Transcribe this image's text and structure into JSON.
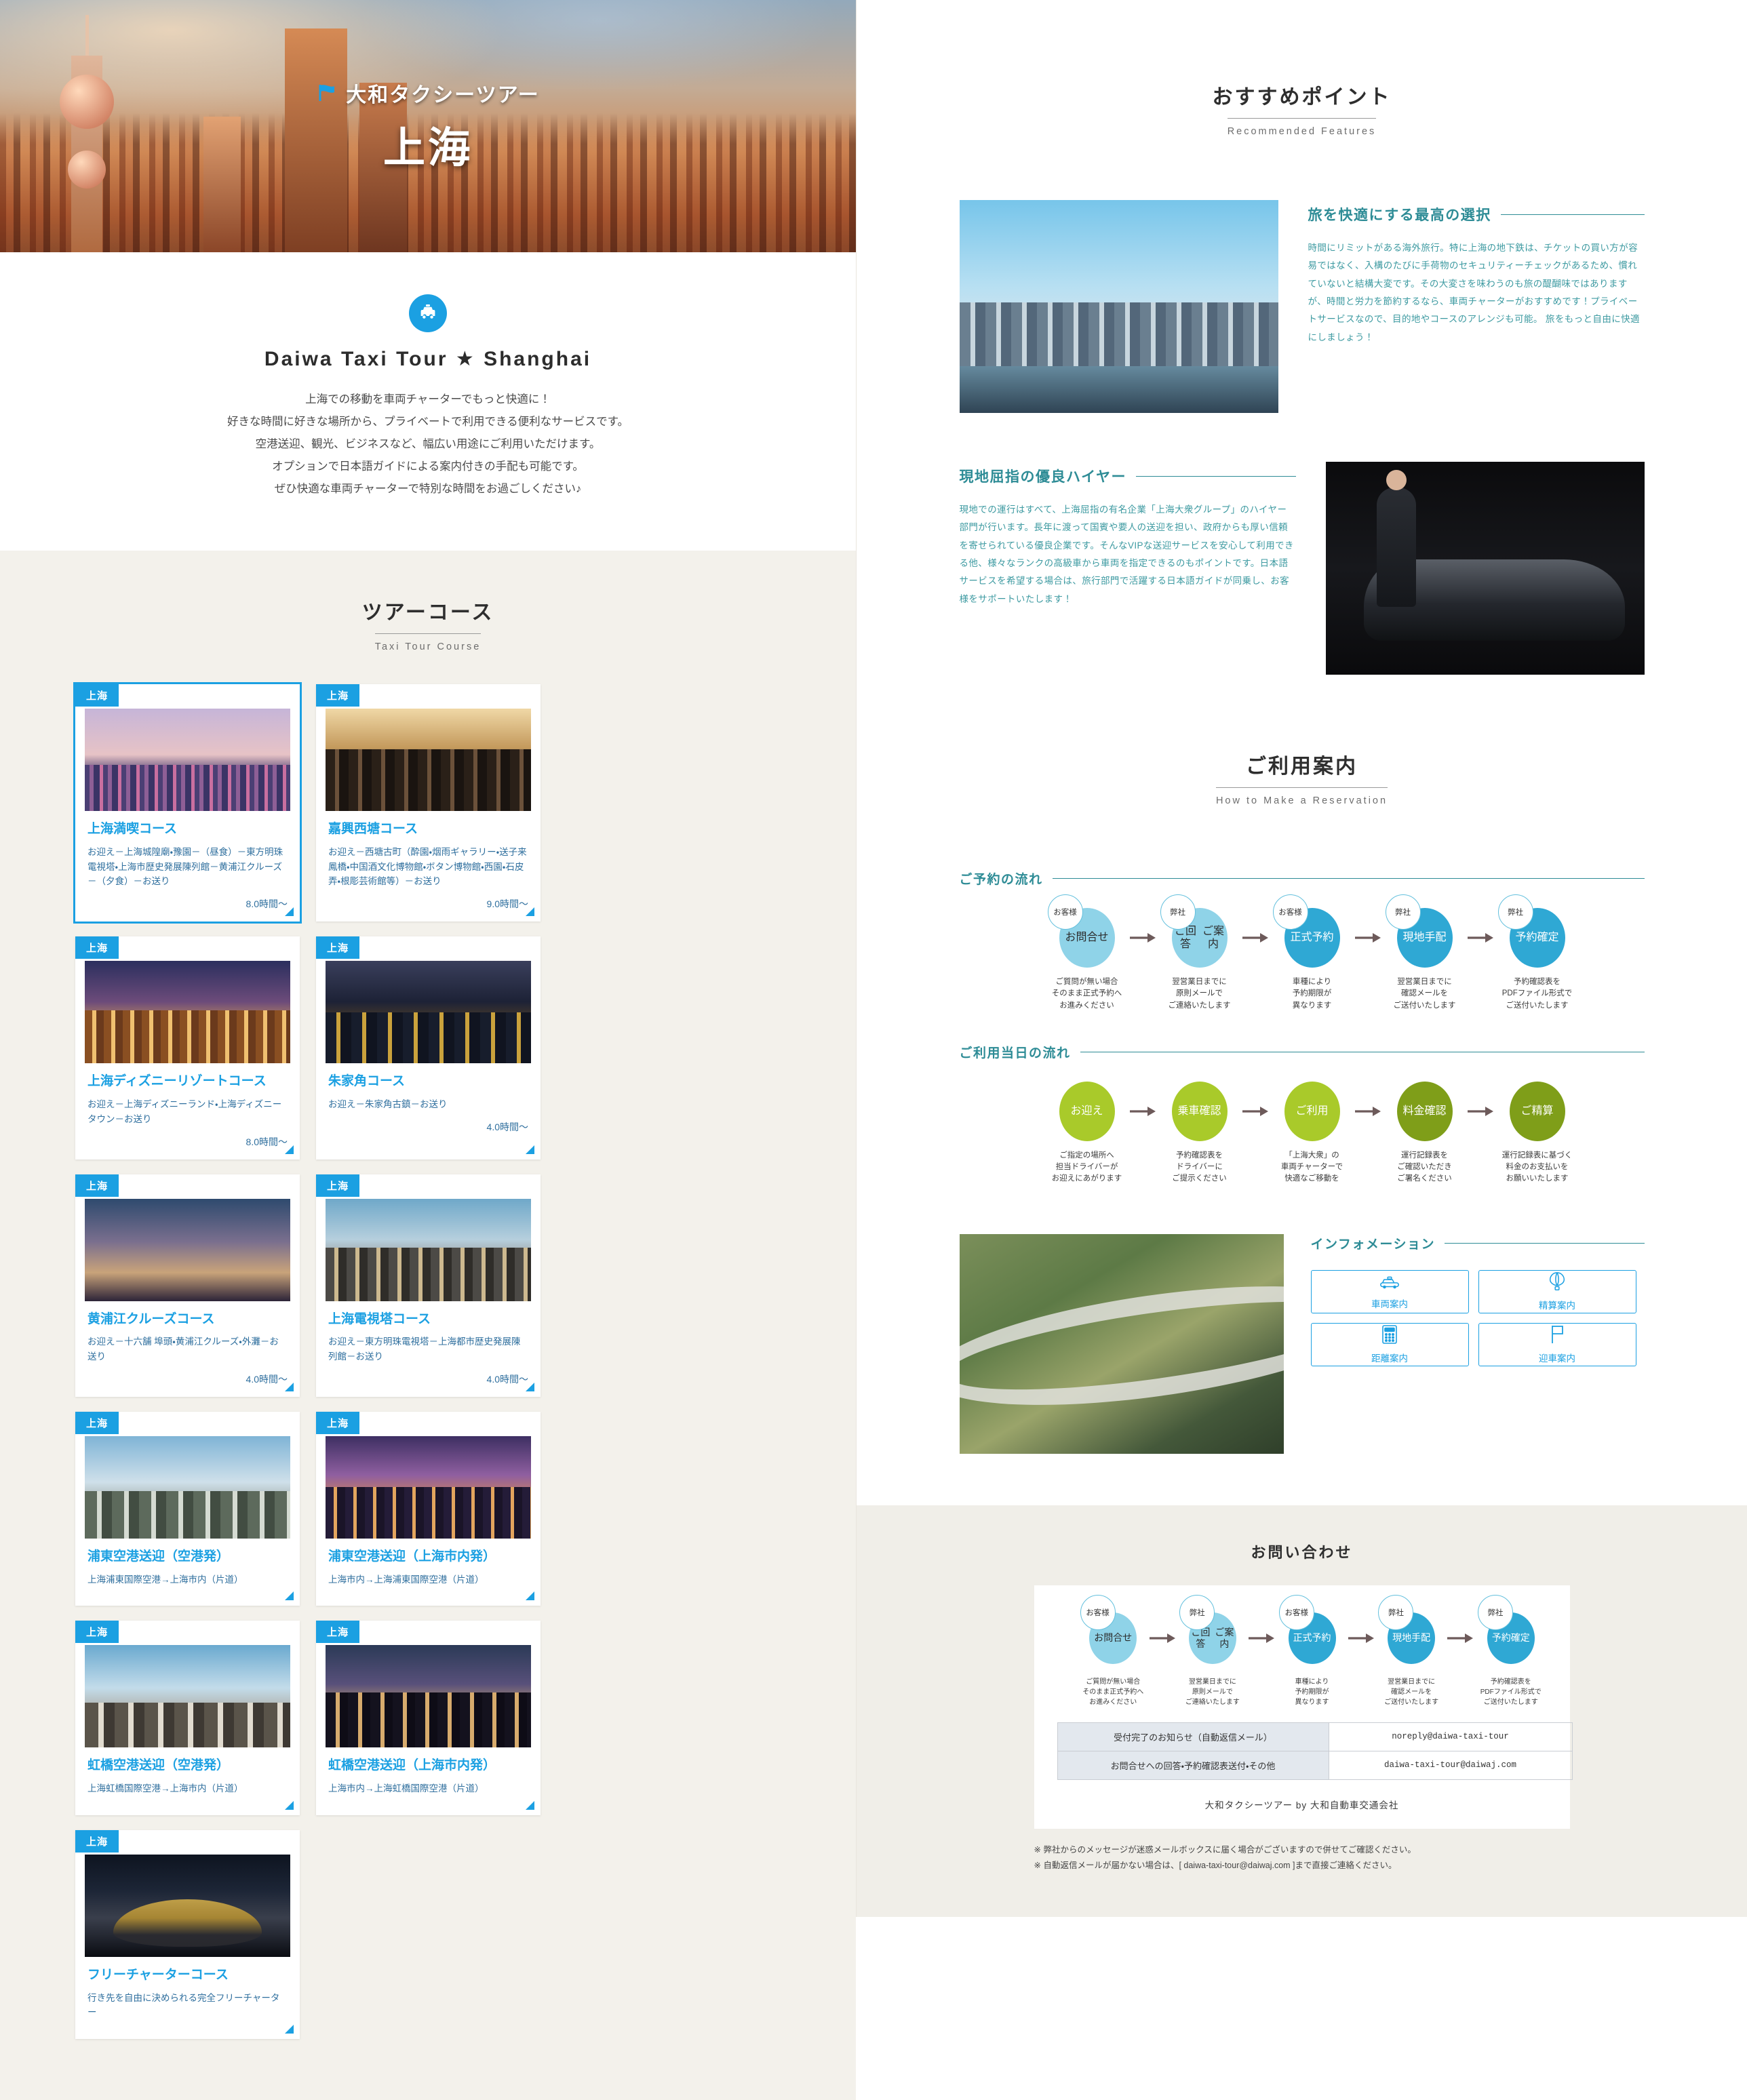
{
  "hero": {
    "kicker": "大和タクシーツアー",
    "title": "上海",
    "flag_icon": "flag-icon"
  },
  "intro": {
    "badge_icon": "taxi-icon",
    "title": "Daiwa Taxi Tour ★ Shanghai",
    "lines": [
      "上海での移動を車両チャーターでもっと快適に！",
      "好きな時間に好きな場所から、プライベートで利用できる便利なサービスです。",
      "空港送迎、観光、ビジネスなど、幅広い用途にご利用いただけます。",
      "オプションで日本語ガイドによる案内付きの手配も可能です。",
      "ぜひ快適な車両チャーターで特別な時間をお過ごしください♪"
    ]
  },
  "courses_section": {
    "heading_ja": "ツアーコース",
    "heading_en": "Taxi Tour Course",
    "tag": "上海",
    "cards": [
      {
        "title": "上海満喫コース",
        "desc": "お迎え－上海城隍廟・豫園－（昼食）－東方明珠電視塔・上海市歴史発展陳列館－黄浦江クルーズ－（夕食）－お送り",
        "time": "8.0時間～",
        "scene": "sc1",
        "active": true
      },
      {
        "title": "嘉興西塘コース",
        "desc": "お迎え－西塘古町（酔園・烟雨ギャラリー・送子来鳳橋・中国酒文化博物館・ボタン博物館・西園・石皮弄・根彫芸術館等）－お送り",
        "time": "9.0時間～",
        "scene": "sc2",
        "active": false
      },
      {
        "title": "上海ディズニーリゾートコース",
        "desc": "お迎え－上海ディズニーランド・上海ディズニータウン－お送り",
        "time": "8.0時間～",
        "scene": "sc3",
        "active": false
      },
      {
        "title": "朱家角コース",
        "desc": "お迎え－朱家角古鎮－お送り",
        "time": "4.0時間～",
        "scene": "sc4",
        "active": false
      },
      {
        "title": "黄浦江クルーズコース",
        "desc": "お迎え－十六舗 埠頭・黄浦江クルーズ・外灘－お送り",
        "time": "4.0時間～",
        "scene": "sc5",
        "active": false
      },
      {
        "title": "上海電視塔コース",
        "desc": "お迎え－東方明珠電視塔－上海都市歴史発展陳列館－お送り",
        "time": "4.0時間～",
        "scene": "sc6",
        "active": false
      },
      {
        "title": "浦東空港送迎（空港発）",
        "desc": "上海浦東国際空港→上海市内（片道）",
        "time": "",
        "scene": "sc7",
        "active": false
      },
      {
        "title": "浦東空港送迎（上海市内発）",
        "desc": "上海市内→上海浦東国際空港（片道）",
        "time": "",
        "scene": "sc8",
        "active": false
      },
      {
        "title": "虹橋空港送迎（空港発）",
        "desc": "上海虹橋国際空港→上海市内（片道）",
        "time": "",
        "scene": "sc9",
        "active": false
      },
      {
        "title": "虹橋空港送迎（上海市内発）",
        "desc": "上海市内→上海虹橋国際空港（片道）",
        "time": "",
        "scene": "sc10",
        "active": false
      },
      {
        "title": "フリーチャーターコース",
        "desc": "行き先を自由に決められる完全フリーチャーター",
        "time": "",
        "scene": "sc11",
        "active": false
      }
    ]
  },
  "recommended": {
    "heading_ja": "おすすめポイント",
    "heading_en": "Recommended Features",
    "features": [
      {
        "title": "旅を快適にする最高の選択",
        "body": "時間にリミットがある海外旅行。特に上海の地下鉄は、チケットの買い方が容易ではなく、入構のたびに手荷物のセキュリティーチェックがあるため、慣れていないと結構大変です。その大変さを味わうのも旅の醍醐味ではありますが、時間と労力を節約するなら、車両チャーターがおすすめです！プライベートサービスなので、目的地やコースのアレンジも可能。 旅をもっと自由に快適にしましょう！",
        "image": "shanghai-skyline-photo"
      },
      {
        "title": "現地屈指の優良ハイヤー",
        "body": "現地での運行はすべて、上海屈指の有名企業「上海大衆グループ」のハイヤー部門が行います。長年に渡って国賓や要人の送迎を担い、政府からも厚い信頼を寄せられている優良企業です。そんなVIPな送迎サービスを安心して利用できる他、様々なランクの高級車から車両を指定できるのもポイントです。日本語サービスを希望する場合は、旅行部門で活躍する日本語ガイドが同乗し、お客様をサポートいたします！",
        "image": "chauffeur-luxury-car-photo"
      }
    ]
  },
  "how_to": {
    "heading_ja": "ご利用案内",
    "heading_en": "How to Make a Reservation",
    "reservation_flow": {
      "label": "ご予約の流れ",
      "steps": [
        {
          "badge": "お客様",
          "name": "お問合せ",
          "caption": "ご質問が無い場合\nそのまま正式予約へ\nお進みください",
          "color": "#8fd3e8"
        },
        {
          "badge": "弊社",
          "name": "ご回答\nご案内",
          "caption": "翌営業日までに\n原則メールで\nご連絡いたします",
          "color": "#8fd3e8"
        },
        {
          "badge": "お客様",
          "name": "正式予約",
          "caption": "車種により\n予約期限が\n異なります",
          "color": "#2fa8d4"
        },
        {
          "badge": "弊社",
          "name": "現地手配",
          "caption": "翌営業日までに\n確認メールを\nご送付いたします",
          "color": "#2fa8d4"
        },
        {
          "badge": "弊社",
          "name": "予約確定",
          "caption": "予約確認表を\nPDFファイル形式で\nご送付いたします",
          "color": "#2fa8d4"
        }
      ]
    },
    "day_flow": {
      "label": "ご利用当日の流れ",
      "steps": [
        {
          "name": "お迎え",
          "caption": "ご指定の場所へ\n担当ドライバーが\nお迎えにあがります",
          "color": "#a9ca2a"
        },
        {
          "name": "乗車確認",
          "caption": "予約確認表を\nドライバーに\nご提示ください",
          "color": "#a9ca2a"
        },
        {
          "name": "ご利用",
          "caption": "「上海大衆」の\n車両チャーターで\n快適なご移動を",
          "color": "#a9ca2a"
        },
        {
          "name": "料金確認",
          "caption": "運行記録表を\nご確認いただき\nご署名ください",
          "color": "#7f9e19"
        },
        {
          "name": "ご精算",
          "caption": "運行記録表に基づく\n料金のお支払いを\nお願いいたします",
          "color": "#7f9e19"
        }
      ]
    },
    "information": {
      "label": "インフォメーション",
      "image": "shanghai-interchange-aerial-photo",
      "buttons": [
        {
          "icon": "taxi-outline-icon",
          "label": "車両案内"
        },
        {
          "icon": "balloon-icon",
          "label": "精算案内"
        },
        {
          "icon": "calculator-icon",
          "label": "距離案内"
        },
        {
          "icon": "flag-outline-icon",
          "label": "迎車案内"
        }
      ]
    }
  },
  "contact": {
    "heading": "お問い合わせ",
    "mail_rows": [
      {
        "kind": "受付完了のお知らせ（自動返信メール）",
        "address": "noreply@daiwa-taxi-tour"
      },
      {
        "kind": "お問合せへの回答・予約確認表送付・その他",
        "address": "daiwa-taxi-tour@daiwaj.com"
      }
    ],
    "byline": "大和タクシーツアー by 大和自動車交通会社",
    "notes": [
      "※ 弊社からのメッセージが迷惑メールボックスに届く場合がございますので併せてご確認ください。",
      "※ 自動返信メールが届かない場合は、[ daiwa-taxi-tour@daiwaj.com ]まで直接ご連絡ください。"
    ]
  },
  "colors": {
    "brand_blue": "#1ba0e2",
    "teal": "#2e8c96",
    "green": "#a9ca2a",
    "green_dark": "#7f9e19",
    "light_blue": "#8fd3e8"
  }
}
